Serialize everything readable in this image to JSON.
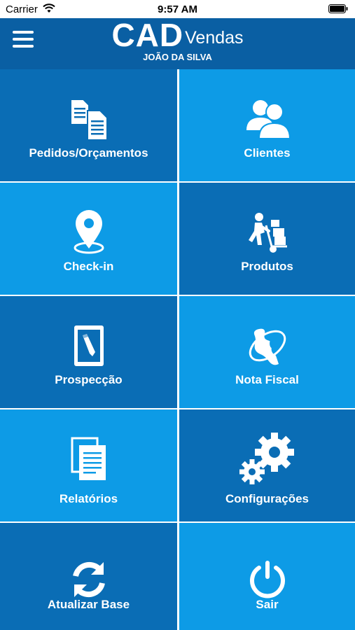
{
  "status_bar": {
    "carrier": "Carrier",
    "time": "9:57 AM"
  },
  "header": {
    "logo_main": "CAD",
    "logo_sub": "Vendas",
    "user_name": "JOÃO DA SILVA",
    "menu_icon": "hamburger-icon"
  },
  "colors": {
    "header_bg": "#0a5fa3",
    "tile_dark": "#0a6db5",
    "tile_light": "#0d9be6"
  },
  "tiles": [
    {
      "label": "Pedidos/Orçamentos",
      "icon": "documents-icon"
    },
    {
      "label": "Clientes",
      "icon": "users-icon"
    },
    {
      "label": "Check-in",
      "icon": "map-pin-icon"
    },
    {
      "label": "Produtos",
      "icon": "delivery-hand-truck-icon"
    },
    {
      "label": "Prospecção",
      "icon": "clipboard-pencil-icon"
    },
    {
      "label": "Nota Fiscal",
      "icon": "nfe-icon"
    },
    {
      "label": "Relatórios",
      "icon": "reports-icon"
    },
    {
      "label": "Configurações",
      "icon": "gears-icon"
    },
    {
      "label": "Atualizar Base",
      "icon": "refresh-icon"
    },
    {
      "label": "Sair",
      "icon": "power-icon"
    }
  ]
}
